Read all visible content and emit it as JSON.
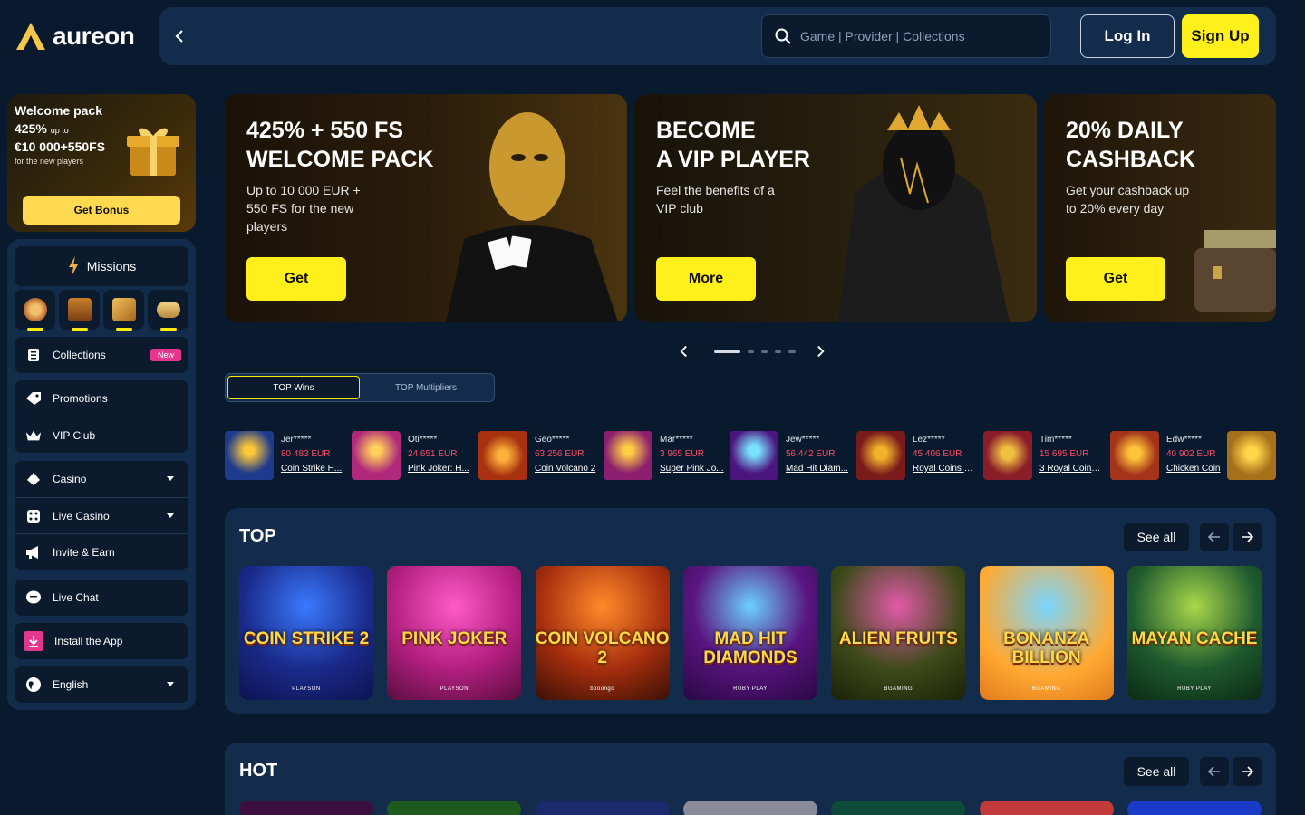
{
  "brand": {
    "name": "aureon",
    "accent": "#ffef1a",
    "bg": "#0a1a2e",
    "panel": "#142c4b"
  },
  "header": {
    "search_placeholder": "Game | Provider | Collections",
    "login_label": "Log In",
    "signup_label": "Sign Up"
  },
  "welcome": {
    "title": "Welcome pack",
    "percent": "425%",
    "upto": "up to",
    "amount": "€10 000+550FS",
    "for_text": "for the new players",
    "button": "Get Bonus"
  },
  "sidebar": {
    "missions_label": "Missions",
    "items": [
      {
        "label": "Collections",
        "icon": "book-icon",
        "badge": "New"
      },
      {
        "label": "Promotions",
        "icon": "tag-icon"
      },
      {
        "label": "VIP Club",
        "icon": "crown-icon"
      },
      {
        "label": "Casino",
        "icon": "spade-icon"
      },
      {
        "label": "Live Casino",
        "icon": "dice-icon"
      },
      {
        "label": "Invite & Earn",
        "icon": "megaphone-icon"
      },
      {
        "label": "Live Chat",
        "icon": "chat-icon"
      },
      {
        "label": "Install the App",
        "icon": "download-icon"
      },
      {
        "label": "English",
        "icon": "globe-icon"
      }
    ]
  },
  "banners": [
    {
      "title_1": "425% + 550 FS",
      "title_2": "WELCOME PACK",
      "text": "Up to 10 000 EUR + 550 FS for the new players",
      "button": "Get"
    },
    {
      "title_1": "BECOME",
      "title_2": "A VIP PLAYER",
      "text": "Feel the benefits of a VIP club",
      "button": "More"
    },
    {
      "title_1": "20% DAILY",
      "title_2": "CASHBACK",
      "text": "Get your cashback up to 20% every day",
      "button": "Get"
    }
  ],
  "tabs": {
    "top_wins": "TOP Wins",
    "top_multipliers": "TOP Multipliers"
  },
  "wins": [
    {
      "user": "Jer*****",
      "amount": "80 483 EUR",
      "game": "Coin Strike H...",
      "color": "#1d3a8c"
    },
    {
      "user": "Oti*****",
      "amount": "24 651 EUR",
      "game": "Pink Joker: H...",
      "color": "#b0287a"
    },
    {
      "user": "Geo*****",
      "amount": "63 256 EUR",
      "game": "Coin Volcano 2",
      "color": "#a8310f"
    },
    {
      "user": "Mar*****",
      "amount": "3 965 EUR",
      "game": "Super Pink Jo...",
      "color": "#8b1e6e"
    },
    {
      "user": "Jew*****",
      "amount": "56 442 EUR",
      "game": "Mad Hit Diam...",
      "color": "#4b1580"
    },
    {
      "user": "Lez*****",
      "amount": "45 406 EUR",
      "game": "Royal Coins 2:...",
      "color": "#7a1b1b"
    },
    {
      "user": "Tim*****",
      "amount": "15 695 EUR",
      "game": "3 Royal Coins:...",
      "color": "#8a1d2a"
    },
    {
      "user": "Edw*****",
      "amount": "40 902 EUR",
      "game": "Chicken Coin",
      "color": "#a3341a"
    }
  ],
  "top_section": {
    "title": "TOP",
    "see_all": "See all",
    "games": [
      {
        "title": "Coin Strike 2",
        "provider": "PLAYSON",
        "bg": "#1a2a8a"
      },
      {
        "title": "Pink Joker",
        "provider": "PLAYSON",
        "bg": "#b21f7f"
      },
      {
        "title": "Coin Volcano 2",
        "provider": "booongo",
        "bg": "#a62e0e"
      },
      {
        "title": "Mad Hit Diamonds",
        "provider": "RUBY PLAY",
        "bg": "#5a1580"
      },
      {
        "title": "Alien Fruits",
        "provider": "BGAMING",
        "bg": "#3d4a1a"
      },
      {
        "title": "Bonanza Billion",
        "provider": "BGAMING",
        "bg": "#ffaa33"
      },
      {
        "title": "Mayan Cache",
        "provider": "RUBY PLAY",
        "bg": "#1e5a2e"
      }
    ]
  },
  "hot_section": {
    "title": "HOT",
    "see_all": "See all"
  }
}
